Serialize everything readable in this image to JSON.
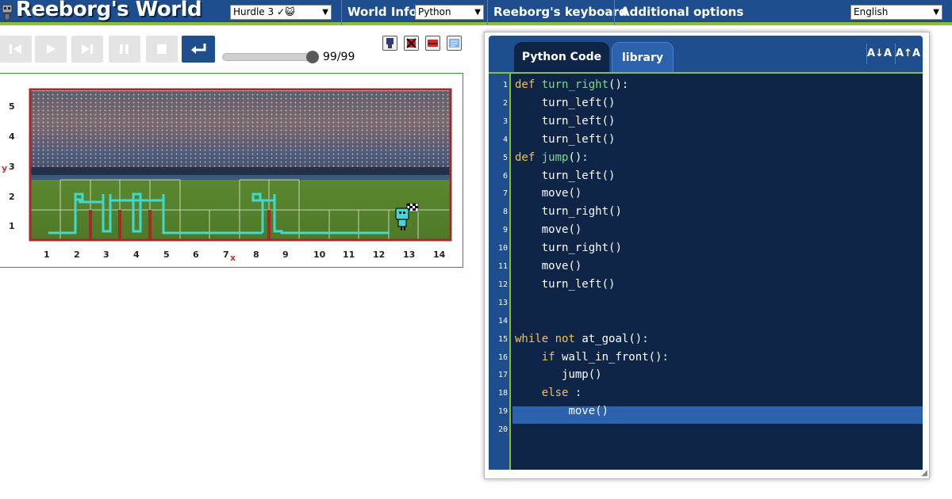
{
  "app": {
    "title": "Reeborg's World"
  },
  "topbar": {
    "world_select": "Hurdle 3 ✓😺",
    "world_info": "World Info",
    "language_select": "Python",
    "keyboard": "Reeborg's keyboard",
    "additional_options": "Additional options",
    "ui_language_select": "English"
  },
  "controls": {
    "step_counter": "99/99",
    "progress": 1.0,
    "icons": [
      "go-to-start-icon",
      "run-icon",
      "step-icon",
      "pause-icon",
      "stop-icon",
      "reverse-step-icon"
    ],
    "tools": [
      "edit-world-icon",
      "remove-object-icon",
      "flag-icon",
      "notes-icon"
    ]
  },
  "world": {
    "x_labels": [
      "1",
      "2",
      "3",
      "4",
      "5",
      "6",
      "7",
      "8",
      "9",
      "10",
      "11",
      "12",
      "13",
      "14"
    ],
    "y_labels": [
      "1",
      "2",
      "3",
      "4",
      "5"
    ],
    "x_axis_letter": "x",
    "y_axis_letter": "y",
    "colors": {
      "border": "#a52a2a",
      "trace": "#3fd9d0",
      "wall": "#a52a2a"
    }
  },
  "editor": {
    "tabs": [
      {
        "label": "Python Code"
      },
      {
        "label": "library"
      }
    ],
    "font_decrease": "A↓A",
    "font_increase": "A↑A",
    "active_line": 19,
    "lines": [
      "def turn_right():",
      "    turn_left()",
      "    turn_left()",
      "    turn_left()",
      "def jump():",
      "    turn_left()",
      "    move()",
      "    turn_right()",
      "    move()",
      "    turn_right()",
      "    move()",
      "    turn_left()",
      "",
      "",
      "while not at_goal():",
      "    if wall_in_front():",
      "       jump()",
      "    else :",
      "        move()",
      ""
    ],
    "colors": {
      "keyword": "#f2c14e",
      "function": "#7fd88a",
      "background": "#0f2548",
      "gutter": "#1f4e8f",
      "accent": "#8fbf2f"
    }
  }
}
